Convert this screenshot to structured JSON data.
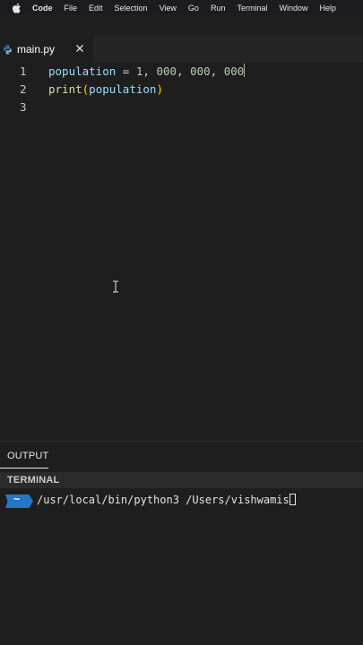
{
  "menubar": {
    "app_name": "Code",
    "items": [
      "File",
      "Edit",
      "Selection",
      "View",
      "Go",
      "Run",
      "Terminal",
      "Window",
      "Help"
    ]
  },
  "tab": {
    "filename": "main.py",
    "icon": "python-icon",
    "close_icon": "close-icon"
  },
  "editor": {
    "line_numbers": [
      "1",
      "2",
      "3"
    ],
    "line1": {
      "var": "population",
      "op": " = ",
      "num1": "1",
      "sep1": ", ",
      "num2": "000",
      "sep2": ", ",
      "num3": "000",
      "sep3": ", ",
      "num4": "000"
    },
    "line2": {
      "fn": "print",
      "open": "(",
      "arg": "population",
      "close": ")"
    }
  },
  "panel": {
    "output_tab": "OUTPUT",
    "terminal_header": "TERMINAL",
    "prompt_symbol": "~",
    "command": "/usr/local/bin/python3 /Users/vishwamis"
  },
  "colors": {
    "background": "#1e1e1e",
    "variable": "#9cdcfe",
    "number": "#b5cea8",
    "function": "#dcdcaa",
    "bracket": "#ffd700",
    "prompt_badge": "#2277c9"
  }
}
